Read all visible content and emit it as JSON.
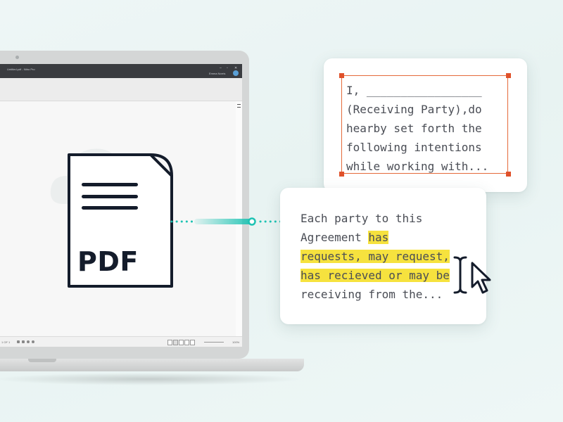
{
  "app": {
    "window_title": "Untitled.pdf - Nitro Pro",
    "user_name": "Emma Norris",
    "window_controls": [
      "–",
      "▫",
      "✕"
    ],
    "status": {
      "page_info": "1 OF 1",
      "zoom": "100%"
    }
  },
  "pdf_icon": {
    "label": "PDF",
    "icon": "document-icon"
  },
  "card_top": {
    "lines": [
      "I, _________________",
      "(Receiving Party),do",
      "hearby set forth the",
      "following intentions",
      "while working with..."
    ]
  },
  "card_bottom": {
    "line1": "Each party to this",
    "line2_plain": "Agreement ",
    "line2_highlight": "has",
    "line3_highlight": "requests, may request,",
    "line4_highlight": "has recieved or may be",
    "line5": "receiving from the..."
  },
  "colors": {
    "accent_teal": "#1ec3b3",
    "selection_orange": "#e0512a",
    "highlight_yellow": "#f6e23e",
    "icon_navy": "#141c2b"
  }
}
